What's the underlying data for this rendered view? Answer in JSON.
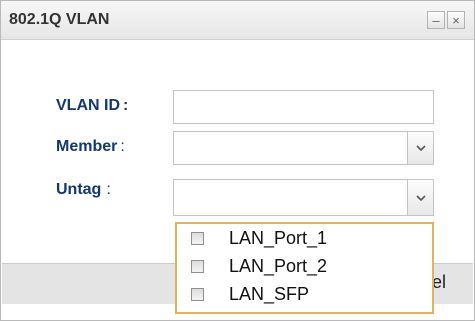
{
  "dialog": {
    "title": "802.1Q VLAN",
    "minimize_glyph": "–",
    "close_glyph": "×"
  },
  "form": {
    "vlan_id_label": "VLAN ID",
    "vlan_id_colon": ":",
    "vlan_id_value": "",
    "member_label": "Member",
    "member_colon": ":",
    "member_value": "",
    "untag_label": "Untag",
    "untag_colon": ":",
    "untag_value": ""
  },
  "untag_options": [
    {
      "label": "LAN_Port_1",
      "checked": false
    },
    {
      "label": "LAN_Port_2",
      "checked": false
    },
    {
      "label": "LAN_SFP",
      "checked": false
    }
  ],
  "footer": {
    "partial_button_text": "el"
  },
  "icons": {
    "dropdown": "chevron-down-icon",
    "minimize": "minimize-icon",
    "close": "close-icon"
  },
  "colors": {
    "label": "#14376c",
    "dropdown_border": "#e2b35d",
    "footer": "#e4e4e4"
  }
}
